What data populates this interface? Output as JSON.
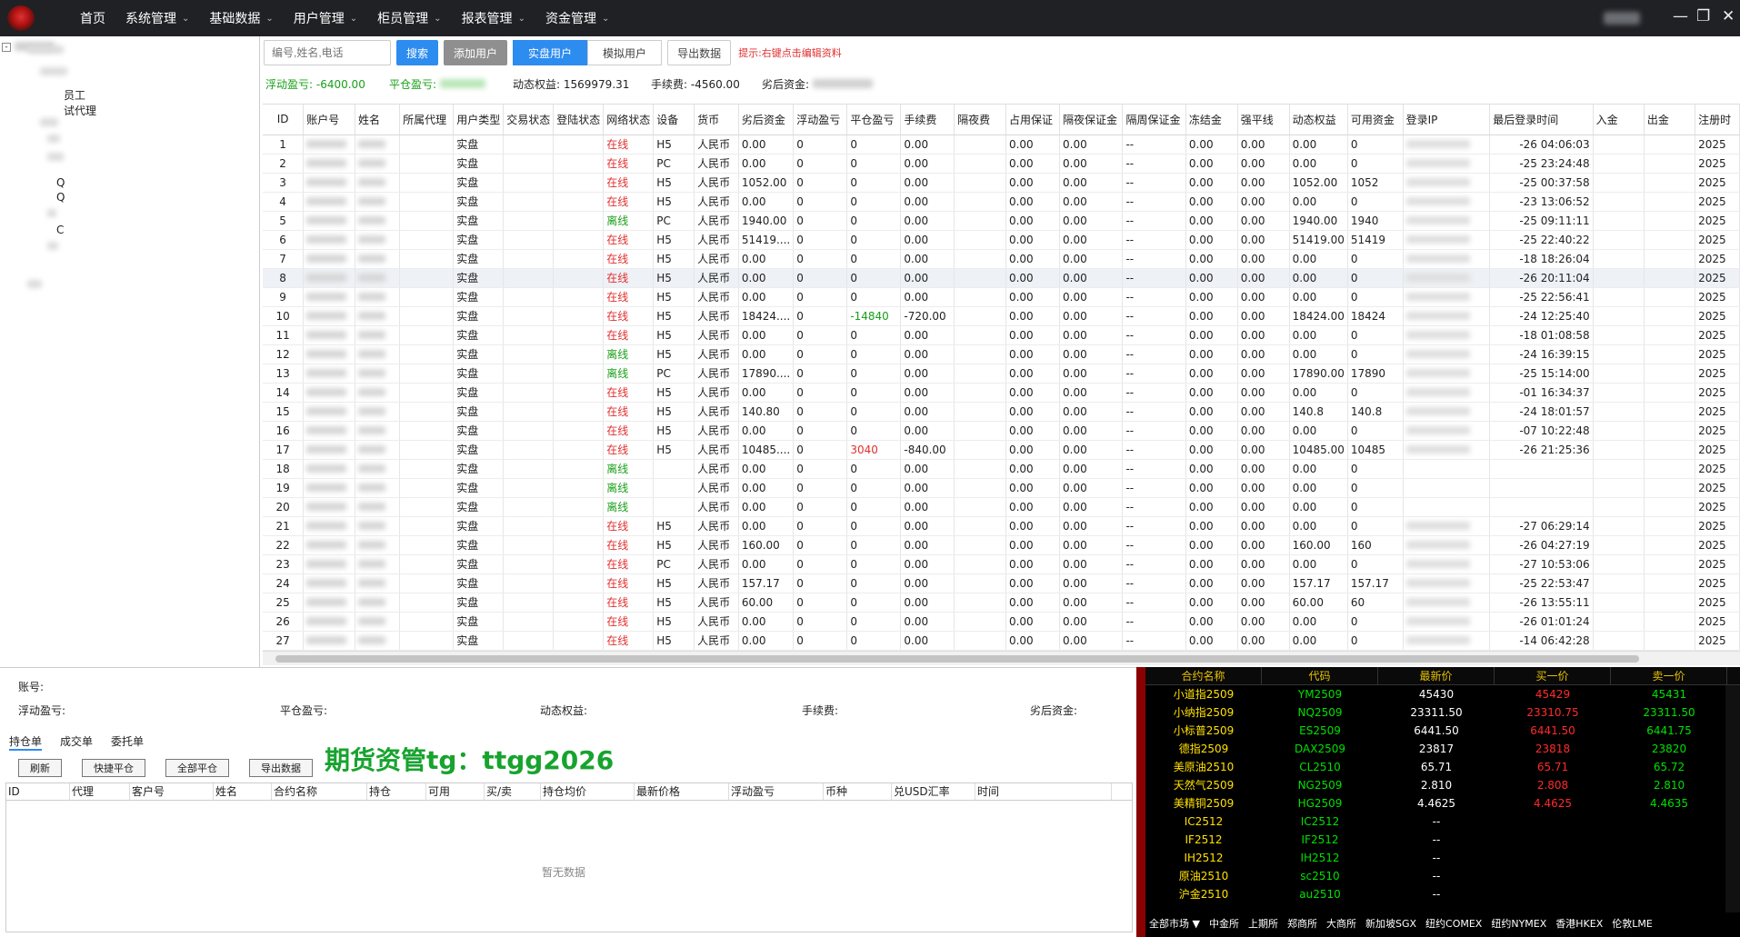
{
  "nav": {
    "items": [
      {
        "label": "首页",
        "chevron": false
      },
      {
        "label": "系统管理",
        "chevron": true
      },
      {
        "label": "基础数据",
        "chevron": true
      },
      {
        "label": "用户管理",
        "chevron": true
      },
      {
        "label": "柜员管理",
        "chevron": true
      },
      {
        "label": "报表管理",
        "chevron": true
      },
      {
        "label": "资金管理",
        "chevron": true
      }
    ],
    "chevron_icon": "chevron-down-icon",
    "window_controls": {
      "minimize": "—",
      "maximize": "❐",
      "close": "✕"
    }
  },
  "tree": {
    "toggle": "-",
    "items": [
      "员工",
      "试代理",
      "Q",
      "Q",
      "C"
    ]
  },
  "toolbar": {
    "search_placeholder": "编号,姓名,电话",
    "search_button": "搜索",
    "add_user": "添加用户",
    "real_user": "实盘用户",
    "sim_user": "模拟用户",
    "export": "导出数据",
    "hint": "提示:右键点击编辑资料"
  },
  "summary": {
    "float_pl_label": "浮动盈亏:",
    "float_pl_value": "-6400.00",
    "close_pl_label": "平仓盈亏:",
    "equity_label": "动态权益:",
    "equity_value": "1569979.31",
    "fee_label": "手续费:",
    "fee_value": "-4560.00",
    "available_label": "劣后资金:"
  },
  "table": {
    "columns": [
      "ID",
      "账户号",
      "姓名",
      "所属代理",
      "用户类型",
      "交易状态",
      "登陆状态",
      "网络状态",
      "设备",
      "货币",
      "劣后资金",
      "浮动盈亏",
      "平仓盈亏",
      "手续费",
      "隔夜费",
      "占用保证",
      "隔夜保证金",
      "隔周保证金",
      "冻结金",
      "强平线",
      "动态权益",
      "可用资金",
      "登录IP",
      "最后登录时间",
      "入金",
      "出金",
      "注册时"
    ],
    "rows": [
      {
        "id": "1",
        "type": "实盘",
        "net": "在线",
        "dev": "H5",
        "cur": "人民币",
        "fund": "0.00",
        "fpl": "0",
        "cpl": "0",
        "fee": "0.00",
        "m1": "0.00",
        "m2": "0.00",
        "m3": "--",
        "frz": "0.00",
        "liq": "0.00",
        "eq": "0.00",
        "avail": "0",
        "time": "-26 04:06:03",
        "reg": "2025"
      },
      {
        "id": "2",
        "type": "实盘",
        "net": "在线",
        "dev": "PC",
        "cur": "人民币",
        "fund": "0.00",
        "fpl": "0",
        "cpl": "0",
        "fee": "0.00",
        "m1": "0.00",
        "m2": "0.00",
        "m3": "--",
        "frz": "0.00",
        "liq": "0.00",
        "eq": "0.00",
        "avail": "0",
        "time": "-25 23:24:48",
        "reg": "2025"
      },
      {
        "id": "3",
        "type": "实盘",
        "net": "在线",
        "dev": "H5",
        "cur": "人民币",
        "fund": "1052.00",
        "fpl": "0",
        "cpl": "0",
        "fee": "0.00",
        "m1": "0.00",
        "m2": "0.00",
        "m3": "--",
        "frz": "0.00",
        "liq": "0.00",
        "eq": "1052.00",
        "avail": "1052",
        "time": "-25 00:37:58",
        "reg": "2025"
      },
      {
        "id": "4",
        "type": "实盘",
        "net": "在线",
        "dev": "H5",
        "cur": "人民币",
        "fund": "0.00",
        "fpl": "0",
        "cpl": "0",
        "fee": "0.00",
        "m1": "0.00",
        "m2": "0.00",
        "m3": "--",
        "frz": "0.00",
        "liq": "0.00",
        "eq": "0.00",
        "avail": "0",
        "time": "-23 13:06:52",
        "reg": "2025"
      },
      {
        "id": "5",
        "type": "实盘",
        "net": "离线",
        "dev": "PC",
        "cur": "人民币",
        "fund": "1940.00",
        "fpl": "0",
        "cpl": "0",
        "fee": "0.00",
        "m1": "0.00",
        "m2": "0.00",
        "m3": "--",
        "frz": "0.00",
        "liq": "0.00",
        "eq": "1940.00",
        "avail": "1940",
        "time": "-25 09:11:11",
        "reg": "2025"
      },
      {
        "id": "6",
        "type": "实盘",
        "net": "在线",
        "dev": "H5",
        "cur": "人民币",
        "fund": "51419....",
        "fpl": "0",
        "cpl": "0",
        "fee": "0.00",
        "m1": "0.00",
        "m2": "0.00",
        "m3": "--",
        "frz": "0.00",
        "liq": "0.00",
        "eq": "51419.00",
        "avail": "51419",
        "time": "-25 22:40:22",
        "reg": "2025"
      },
      {
        "id": "7",
        "type": "实盘",
        "net": "在线",
        "dev": "H5",
        "cur": "人民币",
        "fund": "0.00",
        "fpl": "0",
        "cpl": "0",
        "fee": "0.00",
        "m1": "0.00",
        "m2": "0.00",
        "m3": "--",
        "frz": "0.00",
        "liq": "0.00",
        "eq": "0.00",
        "avail": "0",
        "time": "-18 18:26:04",
        "reg": "2025"
      },
      {
        "id": "8",
        "type": "实盘",
        "net": "在线",
        "dev": "H5",
        "cur": "人民币",
        "fund": "0.00",
        "fpl": "0",
        "cpl": "0",
        "fee": "0.00",
        "m1": "0.00",
        "m2": "0.00",
        "m3": "--",
        "frz": "0.00",
        "liq": "0.00",
        "eq": "0.00",
        "avail": "0",
        "time": "-26 20:11:04",
        "reg": "2025",
        "hl": true
      },
      {
        "id": "9",
        "type": "实盘",
        "net": "在线",
        "dev": "H5",
        "cur": "人民币",
        "fund": "0.00",
        "fpl": "0",
        "cpl": "0",
        "fee": "0.00",
        "m1": "0.00",
        "m2": "0.00",
        "m3": "--",
        "frz": "0.00",
        "liq": "0.00",
        "eq": "0.00",
        "avail": "0",
        "time": "-25 22:56:41",
        "reg": "2025"
      },
      {
        "id": "10",
        "type": "实盘",
        "net": "在线",
        "dev": "H5",
        "cur": "人民币",
        "fund": "18424....",
        "fpl": "0",
        "cpl": "-14840",
        "cplc": "green",
        "fee": "-720.00",
        "m1": "0.00",
        "m2": "0.00",
        "m3": "--",
        "frz": "0.00",
        "liq": "0.00",
        "eq": "18424.00",
        "avail": "18424",
        "time": "-24 12:25:40",
        "reg": "2025"
      },
      {
        "id": "11",
        "type": "实盘",
        "net": "在线",
        "dev": "H5",
        "cur": "人民币",
        "fund": "0.00",
        "fpl": "0",
        "cpl": "0",
        "fee": "0.00",
        "m1": "0.00",
        "m2": "0.00",
        "m3": "--",
        "frz": "0.00",
        "liq": "0.00",
        "eq": "0.00",
        "avail": "0",
        "time": "-18 01:08:58",
        "reg": "2025"
      },
      {
        "id": "12",
        "type": "实盘",
        "net": "离线",
        "dev": "H5",
        "cur": "人民币",
        "fund": "0.00",
        "fpl": "0",
        "cpl": "0",
        "fee": "0.00",
        "m1": "0.00",
        "m2": "0.00",
        "m3": "--",
        "frz": "0.00",
        "liq": "0.00",
        "eq": "0.00",
        "avail": "0",
        "time": "-24 16:39:15",
        "reg": "2025"
      },
      {
        "id": "13",
        "type": "实盘",
        "net": "离线",
        "dev": "PC",
        "cur": "人民币",
        "fund": "17890....",
        "fpl": "0",
        "cpl": "0",
        "fee": "0.00",
        "m1": "0.00",
        "m2": "0.00",
        "m3": "--",
        "frz": "0.00",
        "liq": "0.00",
        "eq": "17890.00",
        "avail": "17890",
        "time": "-25 15:14:00",
        "reg": "2025"
      },
      {
        "id": "14",
        "type": "实盘",
        "net": "在线",
        "dev": "H5",
        "cur": "人民币",
        "fund": "0.00",
        "fpl": "0",
        "cpl": "0",
        "fee": "0.00",
        "m1": "0.00",
        "m2": "0.00",
        "m3": "--",
        "frz": "0.00",
        "liq": "0.00",
        "eq": "0.00",
        "avail": "0",
        "time": "-01 16:34:37",
        "reg": "2025"
      },
      {
        "id": "15",
        "type": "实盘",
        "net": "在线",
        "dev": "H5",
        "cur": "人民币",
        "fund": "140.80",
        "fpl": "0",
        "cpl": "0",
        "fee": "0.00",
        "m1": "0.00",
        "m2": "0.00",
        "m3": "--",
        "frz": "0.00",
        "liq": "0.00",
        "eq": "140.8",
        "avail": "140.8",
        "time": "-24 18:01:57",
        "reg": "2025"
      },
      {
        "id": "16",
        "type": "实盘",
        "net": "在线",
        "dev": "H5",
        "cur": "人民币",
        "fund": "0.00",
        "fpl": "0",
        "cpl": "0",
        "fee": "0.00",
        "m1": "0.00",
        "m2": "0.00",
        "m3": "--",
        "frz": "0.00",
        "liq": "0.00",
        "eq": "0.00",
        "avail": "0",
        "time": "-07 10:22:48",
        "reg": "2025"
      },
      {
        "id": "17",
        "type": "实盘",
        "net": "在线",
        "dev": "H5",
        "cur": "人民币",
        "fund": "10485....",
        "fpl": "0",
        "cpl": "3040",
        "cplc": "red",
        "fee": "-840.00",
        "m1": "0.00",
        "m2": "0.00",
        "m3": "--",
        "frz": "0.00",
        "liq": "0.00",
        "eq": "10485.00",
        "avail": "10485",
        "time": "-26 21:25:36",
        "reg": "2025"
      },
      {
        "id": "18",
        "type": "实盘",
        "net": "离线",
        "dev": "",
        "cur": "人民币",
        "fund": "0.00",
        "fpl": "0",
        "cpl": "0",
        "fee": "0.00",
        "m1": "0.00",
        "m2": "0.00",
        "m3": "--",
        "frz": "0.00",
        "liq": "0.00",
        "eq": "0.00",
        "avail": "0",
        "time": "",
        "reg": "2025"
      },
      {
        "id": "19",
        "type": "实盘",
        "net": "离线",
        "dev": "",
        "cur": "人民币",
        "fund": "0.00",
        "fpl": "0",
        "cpl": "0",
        "fee": "0.00",
        "m1": "0.00",
        "m2": "0.00",
        "m3": "--",
        "frz": "0.00",
        "liq": "0.00",
        "eq": "0.00",
        "avail": "0",
        "time": "",
        "reg": "2025"
      },
      {
        "id": "20",
        "type": "实盘",
        "net": "离线",
        "dev": "",
        "cur": "人民币",
        "fund": "0.00",
        "fpl": "0",
        "cpl": "0",
        "fee": "0.00",
        "m1": "0.00",
        "m2": "0.00",
        "m3": "--",
        "frz": "0.00",
        "liq": "0.00",
        "eq": "0.00",
        "avail": "0",
        "time": "",
        "reg": "2025"
      },
      {
        "id": "21",
        "type": "实盘",
        "net": "在线",
        "dev": "H5",
        "cur": "人民币",
        "fund": "0.00",
        "fpl": "0",
        "cpl": "0",
        "fee": "0.00",
        "m1": "0.00",
        "m2": "0.00",
        "m3": "--",
        "frz": "0.00",
        "liq": "0.00",
        "eq": "0.00",
        "avail": "0",
        "time": "-27 06:29:14",
        "reg": "2025"
      },
      {
        "id": "22",
        "type": "实盘",
        "net": "在线",
        "dev": "H5",
        "cur": "人民币",
        "fund": "160.00",
        "fpl": "0",
        "cpl": "0",
        "fee": "0.00",
        "m1": "0.00",
        "m2": "0.00",
        "m3": "--",
        "frz": "0.00",
        "liq": "0.00",
        "eq": "160.00",
        "avail": "160",
        "time": "-26 04:27:19",
        "reg": "2025"
      },
      {
        "id": "23",
        "type": "实盘",
        "net": "在线",
        "dev": "PC",
        "cur": "人民币",
        "fund": "0.00",
        "fpl": "0",
        "cpl": "0",
        "fee": "0.00",
        "m1": "0.00",
        "m2": "0.00",
        "m3": "--",
        "frz": "0.00",
        "liq": "0.00",
        "eq": "0.00",
        "avail": "0",
        "time": "-27 10:53:06",
        "reg": "2025"
      },
      {
        "id": "24",
        "type": "实盘",
        "net": "在线",
        "dev": "H5",
        "cur": "人民币",
        "fund": "157.17",
        "fpl": "0",
        "cpl": "0",
        "fee": "0.00",
        "m1": "0.00",
        "m2": "0.00",
        "m3": "--",
        "frz": "0.00",
        "liq": "0.00",
        "eq": "157.17",
        "avail": "157.17",
        "time": "-25 22:53:47",
        "reg": "2025"
      },
      {
        "id": "25",
        "type": "实盘",
        "net": "在线",
        "dev": "H5",
        "cur": "人民币",
        "fund": "60.00",
        "fpl": "0",
        "cpl": "0",
        "fee": "0.00",
        "m1": "0.00",
        "m2": "0.00",
        "m3": "--",
        "frz": "0.00",
        "liq": "0.00",
        "eq": "60.00",
        "avail": "60",
        "time": "-26 13:55:11",
        "reg": "2025"
      },
      {
        "id": "26",
        "type": "实盘",
        "net": "在线",
        "dev": "H5",
        "cur": "人民币",
        "fund": "0.00",
        "fpl": "0",
        "cpl": "0",
        "fee": "0.00",
        "m1": "0.00",
        "m2": "0.00",
        "m3": "--",
        "frz": "0.00",
        "liq": "0.00",
        "eq": "0.00",
        "avail": "0",
        "time": "-26 01:01:24",
        "reg": "2025"
      },
      {
        "id": "27",
        "type": "实盘",
        "net": "在线",
        "dev": "H5",
        "cur": "人民币",
        "fund": "0.00",
        "fpl": "0",
        "cpl": "0",
        "fee": "0.00",
        "m1": "0.00",
        "m2": "0.00",
        "m3": "--",
        "frz": "0.00",
        "liq": "0.00",
        "eq": "0.00",
        "avail": "0",
        "time": "-14 06:42:28",
        "reg": "2025"
      }
    ]
  },
  "detail": {
    "account_label": "账号:",
    "float_pl_label": "浮动盈亏:",
    "close_pl_label": "平仓盈亏:",
    "equity_label": "动态权益:",
    "fee_label": "手续费:",
    "available_label": "劣后资金:",
    "tabs": [
      "持仓单",
      "成交单",
      "委托单"
    ],
    "buttons": [
      "刷新",
      "快捷平仓",
      "全部平仓",
      "导出数据"
    ],
    "columns": [
      "ID",
      "代理",
      "客户号",
      "姓名",
      "合约名称",
      "持仓",
      "可用",
      "买/卖",
      "持仓均价",
      "最新价格",
      "浮动盈亏",
      "币种",
      "兑USD汇率",
      "时间"
    ],
    "empty": "暂无数据",
    "watermark": "期货资管tg：ttgg2026"
  },
  "market": {
    "columns": [
      "合约名称",
      "代码",
      "最新价",
      "买一价",
      "卖一价"
    ],
    "rows": [
      {
        "name": "小道指2509",
        "code": "YM2509",
        "last": "45430",
        "bid": "45429",
        "ask": "45431"
      },
      {
        "name": "小纳指2509",
        "code": "NQ2509",
        "last": "23311.50",
        "bid": "23310.75",
        "ask": "23311.50"
      },
      {
        "name": "小标普2509",
        "code": "ES2509",
        "last": "6441.50",
        "bid": "6441.50",
        "ask": "6441.75"
      },
      {
        "name": "德指2509",
        "code": "DAX2509",
        "last": "23817",
        "bid": "23818",
        "ask": "23820"
      },
      {
        "name": "美原油2510",
        "code": "CL2510",
        "last": "65.71",
        "bid": "65.71",
        "ask": "65.72"
      },
      {
        "name": "天然气2509",
        "code": "NG2509",
        "last": "2.810",
        "bid": "2.808",
        "ask": "2.810"
      },
      {
        "name": "美精铜2509",
        "code": "HG2509",
        "last": "4.4625",
        "bid": "4.4625",
        "ask": "4.4635"
      },
      {
        "name": "IC2512",
        "code": "IC2512",
        "last": "--",
        "bid": "",
        "ask": ""
      },
      {
        "name": "IF2512",
        "code": "IF2512",
        "last": "--",
        "bid": "",
        "ask": ""
      },
      {
        "name": "IH2512",
        "code": "IH2512",
        "last": "--",
        "bid": "",
        "ask": ""
      },
      {
        "name": "原油2510",
        "code": "sc2510",
        "last": "--",
        "bid": "",
        "ask": ""
      },
      {
        "name": "沪金2510",
        "code": "au2510",
        "last": "--",
        "bid": "",
        "ask": ""
      }
    ],
    "footer": [
      "全部市场 ▼",
      "中金所",
      "上期所",
      "郑商所",
      "大商所",
      "新加坡SGX",
      "纽约COMEX",
      "纽约NYMEX",
      "香港HKEX",
      "伦敦LME"
    ],
    "colors": {
      "name": "#ffe000",
      "code": "#00e000",
      "last": "#ffffff",
      "bid": "#ff2a2a",
      "ask": "#00e000"
    }
  }
}
